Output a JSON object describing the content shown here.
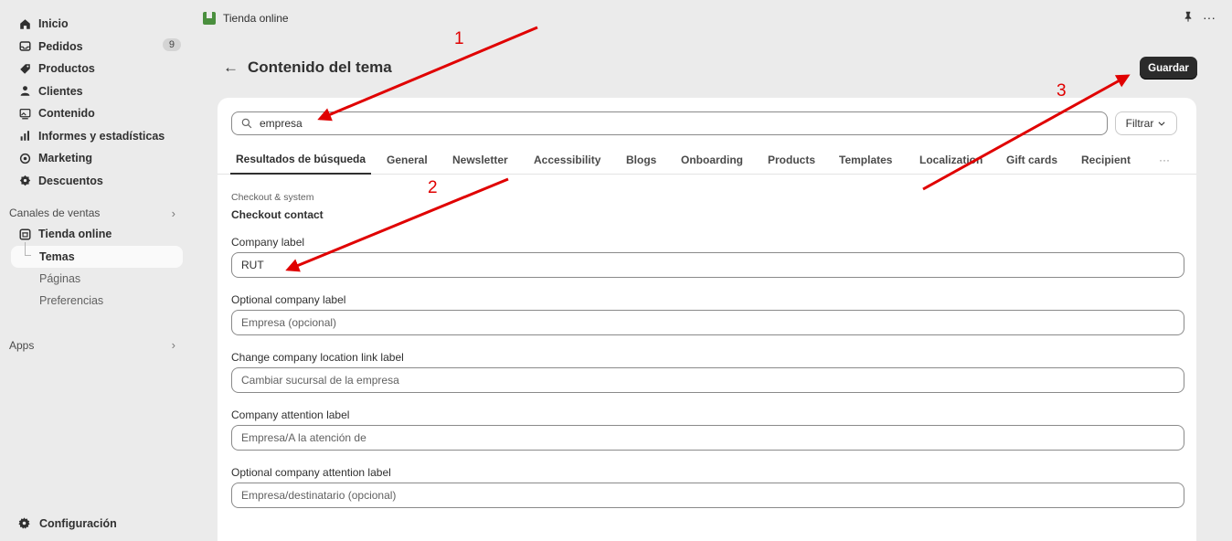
{
  "sidebar": {
    "items": [
      {
        "label": "Inicio"
      },
      {
        "label": "Pedidos",
        "badge": "9"
      },
      {
        "label": "Productos"
      },
      {
        "label": "Clientes"
      },
      {
        "label": "Contenido"
      },
      {
        "label": "Informes y estadísticas"
      },
      {
        "label": "Marketing"
      },
      {
        "label": "Descuentos"
      }
    ],
    "sales_channels_label": "Canales de ventas",
    "online_store": "Tienda online",
    "sub_items": [
      "Temas",
      "Páginas",
      "Preferencias"
    ],
    "apps_label": "Apps",
    "settings_label": "Configuración"
  },
  "topbar": {
    "app_title": "Tienda online",
    "more": "···"
  },
  "page": {
    "title": "Contenido del tema",
    "back": "←",
    "save_label": "Guardar"
  },
  "search": {
    "value": "empresa",
    "filter_label": "Filtrar"
  },
  "tabs": [
    {
      "label": "Resultados de búsqueda",
      "active": true
    },
    {
      "label": "General"
    },
    {
      "label": "Newsletter"
    },
    {
      "label": "Accessibility"
    },
    {
      "label": "Blogs"
    },
    {
      "label": "Onboarding"
    },
    {
      "label": "Products"
    },
    {
      "label": "Templates"
    },
    {
      "label": "Localization"
    },
    {
      "label": "Gift cards"
    },
    {
      "label": "Recipient"
    },
    {
      "label": "···"
    }
  ],
  "content": {
    "breadcrumb": "Checkout & system",
    "group_title": "Checkout contact",
    "fields": [
      {
        "label": "Company label",
        "value": "RUT",
        "filled": true
      },
      {
        "label": "Optional company label",
        "value": "Empresa (opcional)"
      },
      {
        "label": "Change company location link label",
        "value": "Cambiar sucursal de la empresa"
      },
      {
        "label": "Company attention label",
        "value": "Empresa/A la atención de"
      },
      {
        "label": "Optional company attention label",
        "value": "Empresa/destinatario (opcional)"
      }
    ]
  },
  "annotations": {
    "arrow_color": "#e00000",
    "markers": [
      "1",
      "2",
      "3"
    ]
  }
}
